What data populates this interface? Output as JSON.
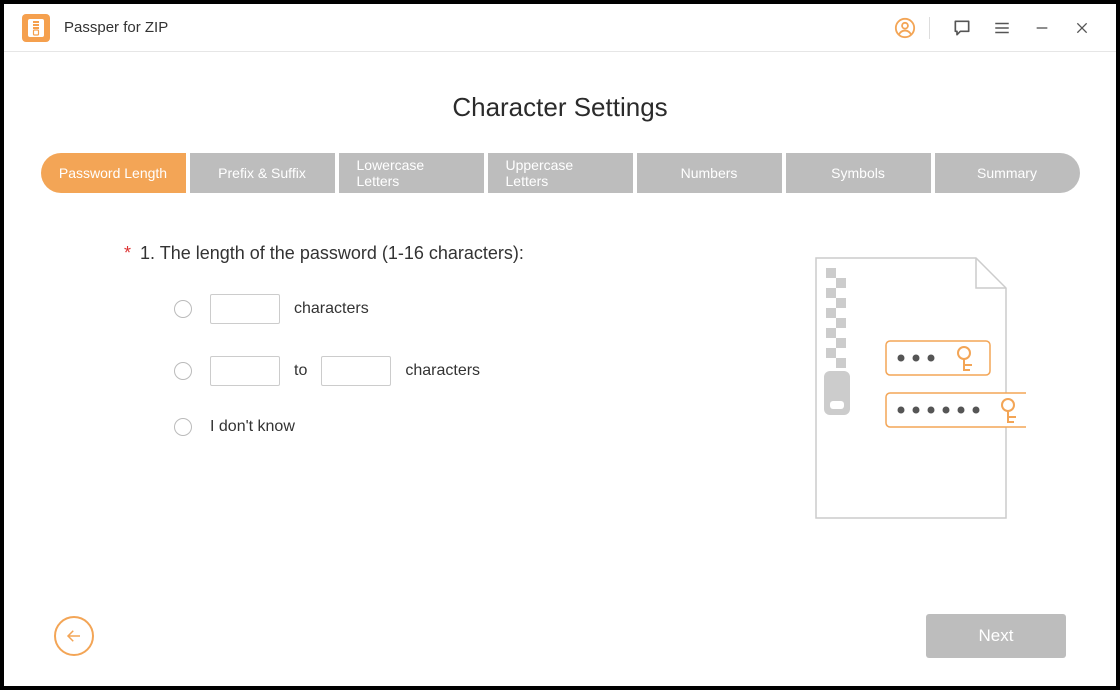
{
  "app": {
    "title": "Passper for ZIP"
  },
  "page": {
    "title": "Character Settings"
  },
  "tabs": [
    {
      "label": "Password Length",
      "active": true
    },
    {
      "label": "Prefix & Suffix"
    },
    {
      "label": "Lowercase Letters"
    },
    {
      "label": "Uppercase Letters"
    },
    {
      "label": "Numbers"
    },
    {
      "label": "Symbols"
    },
    {
      "label": "Summary"
    }
  ],
  "question": {
    "required_mark": "*",
    "prompt": "1. The length of the password (1-16 characters):",
    "option_exact": {
      "value": "",
      "suffix": "characters"
    },
    "option_range": {
      "from": "",
      "to": "",
      "joiner": "to",
      "suffix": "characters"
    },
    "option_unknown": {
      "label": "I don't know"
    }
  },
  "nav": {
    "next": "Next"
  },
  "colors": {
    "accent": "#f3a556"
  }
}
